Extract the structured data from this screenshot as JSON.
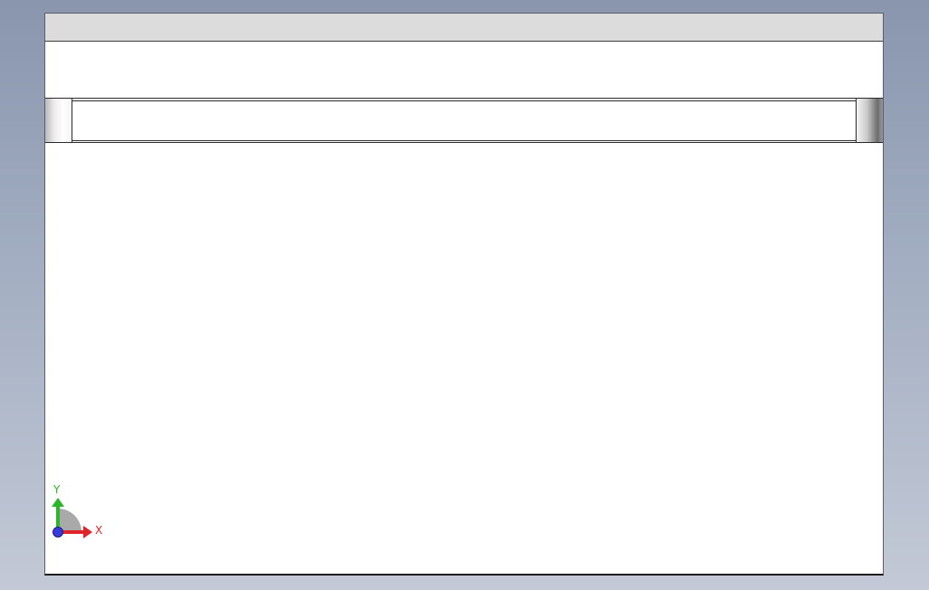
{
  "triad": {
    "x_label": "X",
    "y_label": "Y",
    "x_color": "#e0242a",
    "y_color": "#2bb52b",
    "origin_color": "#3a3ad6"
  }
}
